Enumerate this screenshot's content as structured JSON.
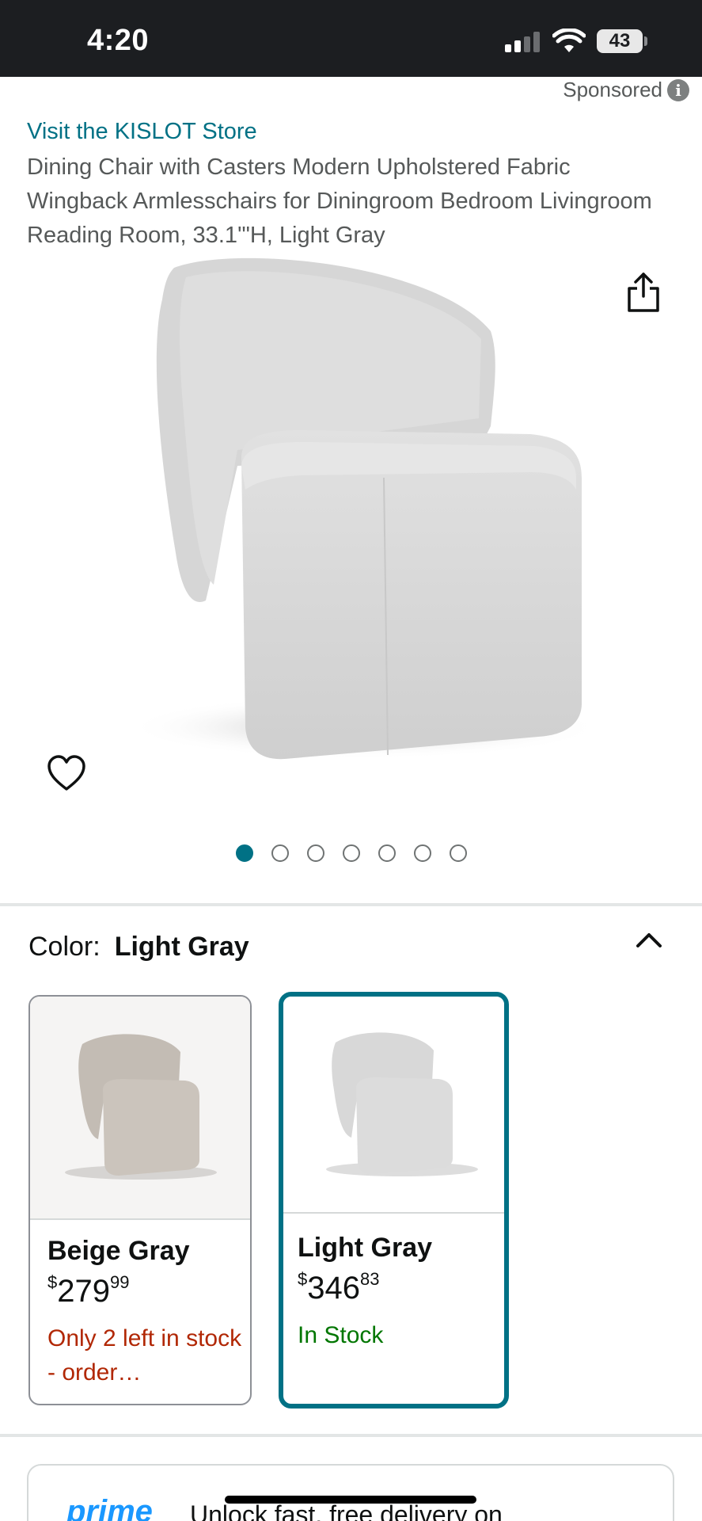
{
  "status_bar": {
    "time": "4:20",
    "battery": "43"
  },
  "sponsored": {
    "label": "Sponsored"
  },
  "product": {
    "store_link": "Visit the KISLOT Store",
    "title": "Dining Chair with Casters Modern Upholstered Fabric Wingback Armlesschairs for Diningroom Bedroom Livingroom Reading Room, 33.1'\"H, Light Gray"
  },
  "carousel": {
    "count": 7,
    "active_index": 0
  },
  "color_selector": {
    "label": "Color:",
    "selected": "Light Gray",
    "options": [
      {
        "name": "Beige Gray",
        "price_symbol": "$",
        "price_whole": "279",
        "price_fraction": "99",
        "availability": "Only 2 left in stock - order…",
        "selected": false
      },
      {
        "name": "Light Gray",
        "price_symbol": "$",
        "price_whole": "346",
        "price_fraction": "83",
        "availability": "In Stock",
        "selected": true
      }
    ]
  },
  "prime_banner": {
    "logo": "prime",
    "text": "Unlock fast, free delivery on"
  },
  "colors": {
    "link": "#007185",
    "low_stock": "#b12704",
    "in_stock": "#007600",
    "prime": "#1a98ff"
  },
  "icons": [
    "info-icon",
    "share-icon",
    "heart-icon",
    "chevron-up-icon",
    "wifi-icon",
    "signal-icon",
    "battery-icon"
  ]
}
